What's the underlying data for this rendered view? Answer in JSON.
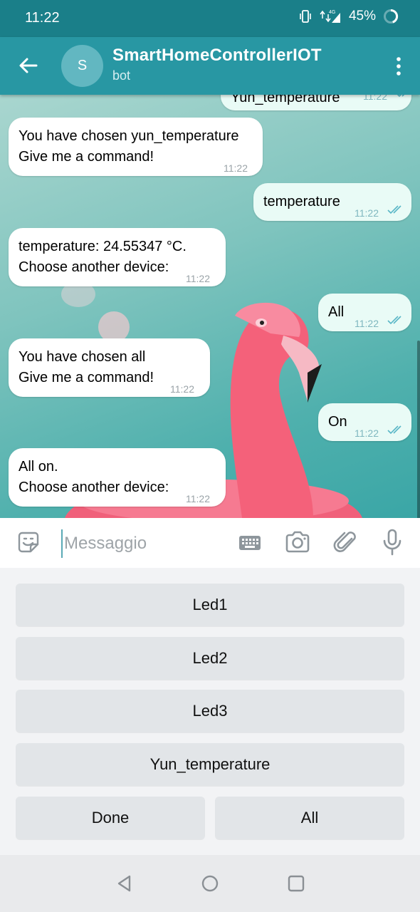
{
  "status_bar": {
    "time": "11:22",
    "network": "4G",
    "battery": "45%"
  },
  "header": {
    "avatar_letter": "S",
    "title": "SmartHomeControllerIOT",
    "subtitle": "bot"
  },
  "messages": [
    {
      "direction": "out",
      "lines": [
        "Yun_temperature"
      ],
      "time": "11:22",
      "read": true
    },
    {
      "direction": "in",
      "lines": [
        "You have chosen yun_temperature",
        "Give me a command!"
      ],
      "time": "11:22"
    },
    {
      "direction": "out",
      "lines": [
        "temperature"
      ],
      "time": "11:22",
      "read": true
    },
    {
      "direction": "in",
      "lines": [
        "temperature: 24.55347 °C.",
        "Choose another device:"
      ],
      "time": "11:22"
    },
    {
      "direction": "out",
      "lines": [
        "All"
      ],
      "time": "11:22",
      "read": true
    },
    {
      "direction": "in",
      "lines": [
        "You have chosen all",
        "Give me a command!"
      ],
      "time": "11:22"
    },
    {
      "direction": "out",
      "lines": [
        "On"
      ],
      "time": "11:22",
      "read": true
    },
    {
      "direction": "in",
      "lines": [
        "All on.",
        "Choose another device:"
      ],
      "time": "11:22"
    }
  ],
  "composer": {
    "placeholder": "Messaggio"
  },
  "keyboard_buttons": {
    "led1": "Led1",
    "led2": "Led2",
    "led3": "Led3",
    "yun_temperature": "Yun_temperature",
    "done": "Done",
    "all": "All"
  },
  "icons": {
    "back": "arrow-left-icon",
    "menu": "more-vertical-icon",
    "emoji": "sticker-emoji-icon",
    "keyboard": "keyboard-icon",
    "camera": "camera-icon",
    "attach": "paperclip-icon",
    "mic": "microphone-icon"
  },
  "colors": {
    "status_bar": "#1a7f89",
    "header": "#2897a3",
    "incoming_bubble": "#ffffff",
    "outgoing_bubble": "#e9fbf6",
    "read_checks": "#5ab7c7",
    "keyboard_button": "#e2e5e8"
  }
}
